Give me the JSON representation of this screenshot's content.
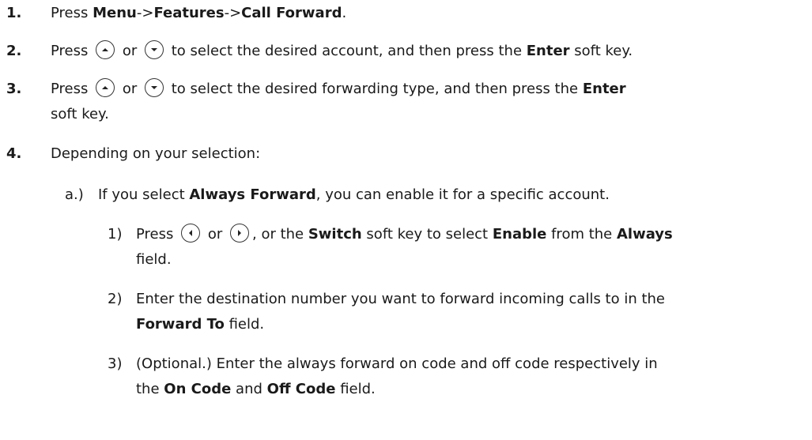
{
  "steps": [
    {
      "num": "1.",
      "pre": "Press ",
      "b1": "Menu",
      "sep1": "->",
      "b2": "Features",
      "sep2": "->",
      "b3": "Call Forward",
      "end": "."
    },
    {
      "num": "2.",
      "pre": "Press",
      "or": "or",
      "mid": "to select the desired account, and then press the ",
      "bold": "Enter",
      "end": " soft key."
    },
    {
      "num": "3.",
      "pre": "Press",
      "or": "or",
      "mid": "to select the desired forwarding type, and then press the ",
      "bold": "Enter",
      "cont": "soft key."
    },
    {
      "num": "4.",
      "text": "Depending on your selection:"
    }
  ],
  "sub_a": {
    "label": "a.)",
    "pre": "If you select ",
    "bold": "Always Forward",
    "end": ", you can enable it for a specific account."
  },
  "items": [
    {
      "num": "1)",
      "pre": "Press",
      "or": "or",
      "mid": ", or the ",
      "b1": "Switch",
      "mid2": " soft key to select ",
      "b2": "Enable",
      "mid3": " from the ",
      "b3": "Always",
      "cont": "field."
    },
    {
      "num": "2)",
      "text": "Enter the destination number you want to forward incoming calls to in the",
      "cont_bold": "Forward To",
      "cont_end": " field."
    },
    {
      "num": "3)",
      "text": "(Optional.) Enter the always forward on code and off code respectively in",
      "cont_pre": "the ",
      "cont_b1": "On Code",
      "cont_mid": " and ",
      "cont_b2": "Off Code",
      "cont_end": " field."
    }
  ],
  "icons": {
    "up": "up-arrow-key-icon",
    "down": "down-arrow-key-icon",
    "left": "left-arrow-key-icon",
    "right": "right-arrow-key-icon"
  }
}
